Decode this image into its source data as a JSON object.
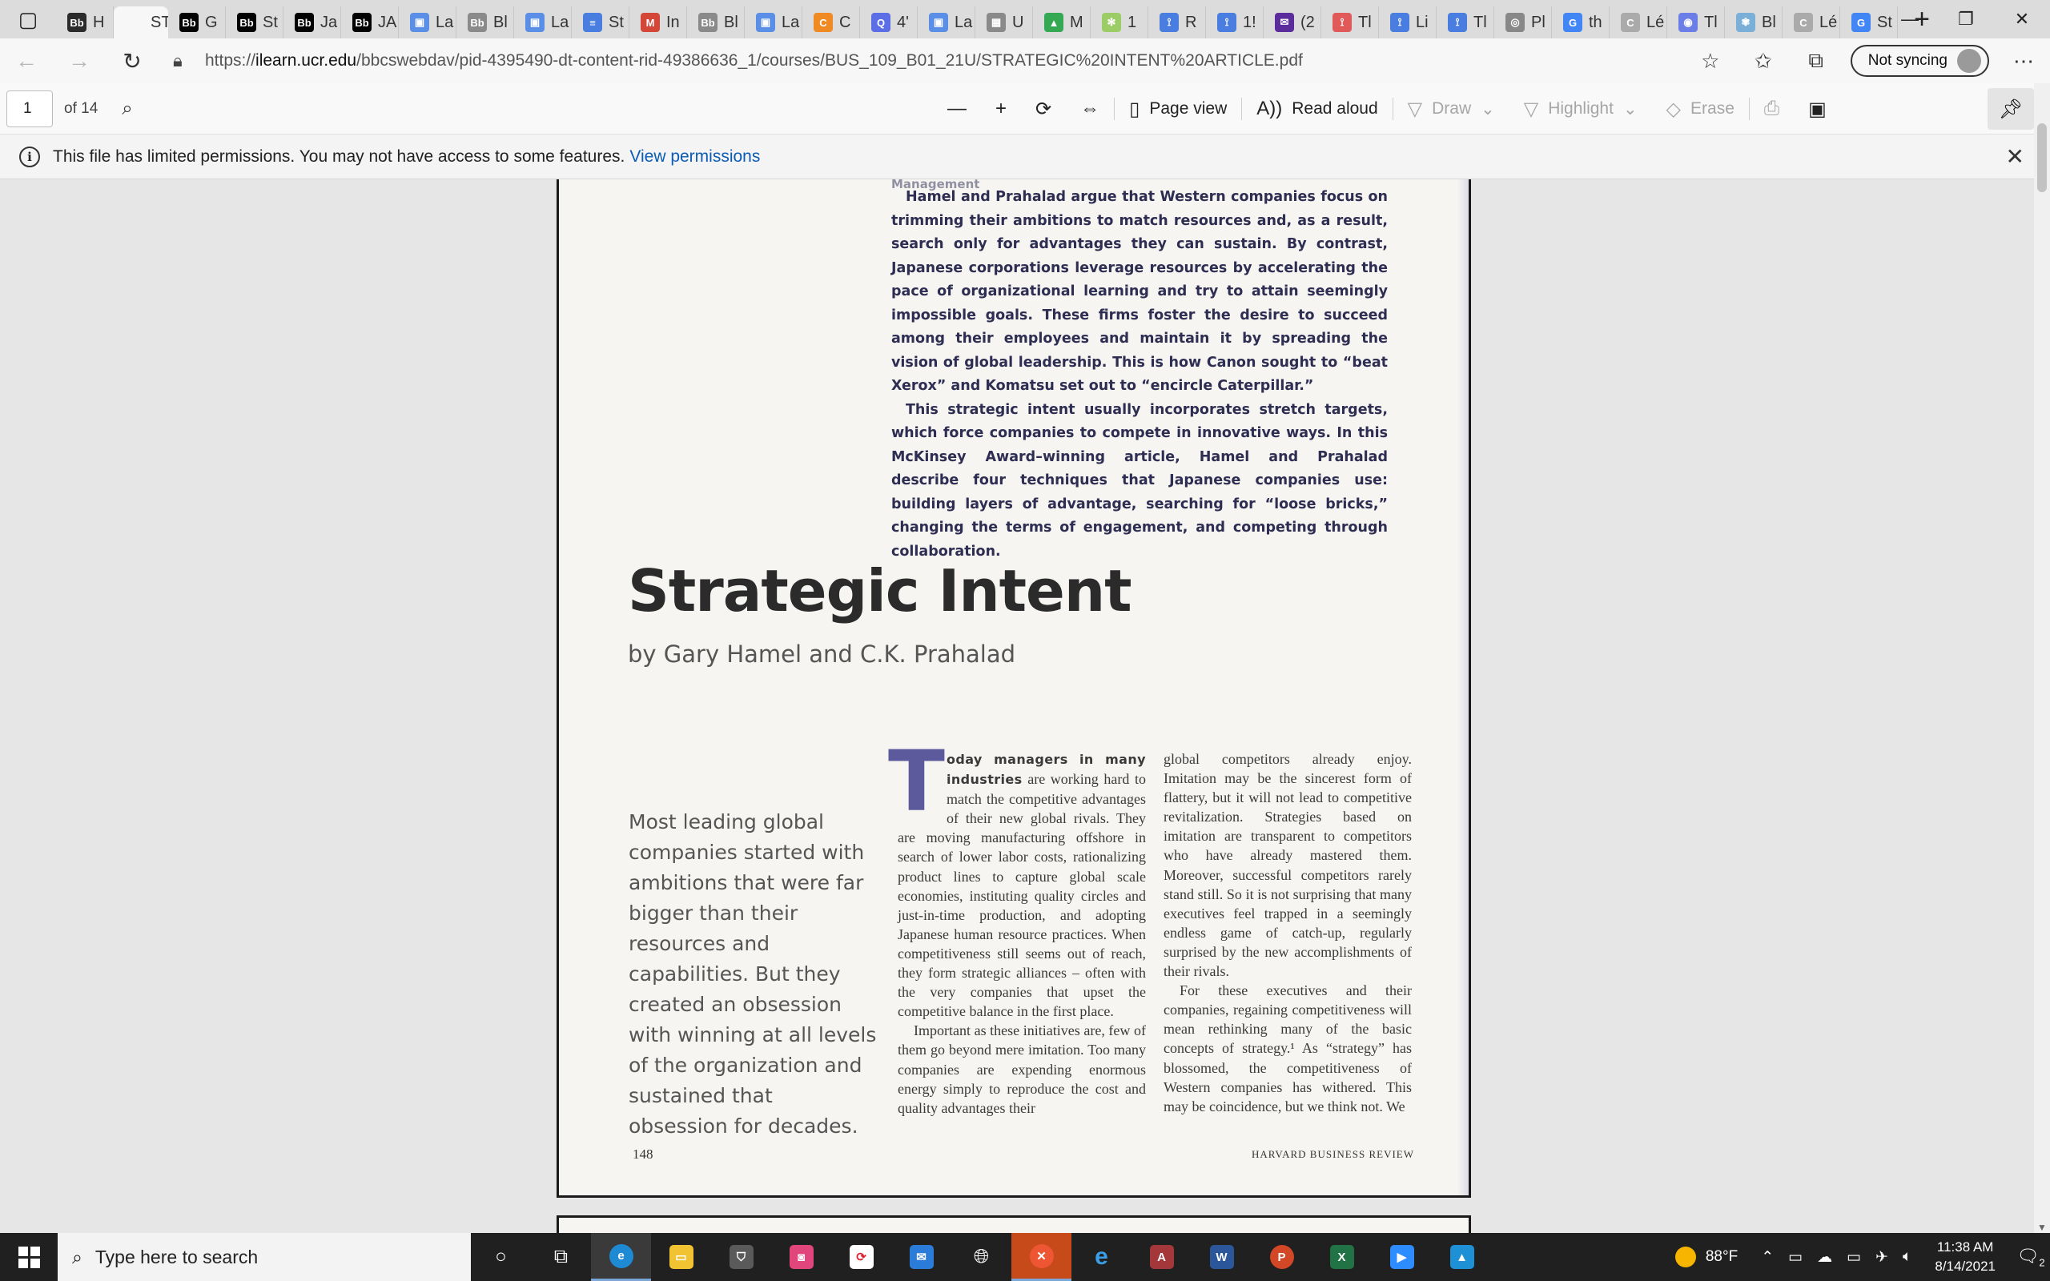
{
  "browser": {
    "tabs": [
      {
        "fav": "Bb",
        "label": "H",
        "color": "#2b2b2b"
      },
      {
        "fav": "",
        "label": "ST",
        "color": "#f7f7f7",
        "active": true
      },
      {
        "fav": "Bb",
        "label": "G",
        "color": "#000"
      },
      {
        "fav": "Bb",
        "label": "St",
        "color": "#000"
      },
      {
        "fav": "Bb",
        "label": "Ja",
        "color": "#000"
      },
      {
        "fav": "Bb",
        "label": "JA",
        "color": "#000"
      },
      {
        "fav": "▣",
        "label": "La",
        "color": "#5b8ee6"
      },
      {
        "fav": "Bb",
        "label": "Bl",
        "color": "#8a8a8a"
      },
      {
        "fav": "▣",
        "label": "La",
        "color": "#5b8ee6"
      },
      {
        "fav": "≡",
        "label": "St",
        "color": "#4a7de0"
      },
      {
        "fav": "M",
        "label": "In",
        "color": "#d44638"
      },
      {
        "fav": "Bb",
        "label": "Bl",
        "color": "#8a8a8a"
      },
      {
        "fav": "▣",
        "label": "La",
        "color": "#5b8ee6"
      },
      {
        "fav": "C",
        "label": "C",
        "color": "#f08a24"
      },
      {
        "fav": "Q",
        "label": "4'",
        "color": "#5b6ee6"
      },
      {
        "fav": "▣",
        "label": "La",
        "color": "#5b8ee6"
      },
      {
        "fav": "▦",
        "label": "U",
        "color": "#8a8a8a"
      },
      {
        "fav": "▲",
        "label": "M",
        "color": "#34a853"
      },
      {
        "fav": "✻",
        "label": "1",
        "color": "#9ccc65"
      },
      {
        "fav": "⟟",
        "label": "R",
        "color": "#4a7de0"
      },
      {
        "fav": "⟟",
        "label": "1!",
        "color": "#4a7de0"
      },
      {
        "fav": "✉",
        "label": "(2",
        "color": "#5b2c9c"
      },
      {
        "fav": "⟟",
        "label": "Tl",
        "color": "#e05a5a"
      },
      {
        "fav": "⟟",
        "label": "Li",
        "color": "#4a7de0"
      },
      {
        "fav": "⟟",
        "label": "Tl",
        "color": "#4a7de0"
      },
      {
        "fav": "◎",
        "label": "Pl",
        "color": "#888"
      },
      {
        "fav": "G",
        "label": "th",
        "color": "#4285f4"
      },
      {
        "fav": "C",
        "label": "Lé",
        "color": "#aaa"
      },
      {
        "fav": "◉",
        "label": "Tl",
        "color": "#6b7de6"
      },
      {
        "fav": "✾",
        "label": "Bl",
        "color": "#7ab0d8"
      },
      {
        "fav": "C",
        "label": "Lé",
        "color": "#aaa"
      },
      {
        "fav": "G",
        "label": "St",
        "color": "#4285f4"
      }
    ],
    "url_prefix": "https://",
    "url_domain": "ilearn.ucr.edu",
    "url_path": "/bbcswebdav/pid-4395490-dt-content-rid-49386636_1/courses/BUS_109_B01_21U/STRATEGIC%20INTENT%20ARTICLE.pdf",
    "sync_label": "Not syncing"
  },
  "pdf": {
    "page_number": "1",
    "page_total": "of 14",
    "tools": {
      "page_view": "Page view",
      "read_aloud": "Read aloud",
      "draw": "Draw",
      "highlight": "Highlight",
      "erase": "Erase"
    },
    "info_message": "This file has limited permissions. You may not have access to some features.",
    "info_link": "View permissions"
  },
  "article": {
    "abstract_cut": "Management",
    "abstract_p1": "Hamel and Prahalad argue that Western companies focus on trimming their ambitions to match resources and, as a result, search only for advantages they can sustain. By contrast, Japanese corporations leverage resources by accelerating the pace of organizational learning and try to attain seemingly impossible goals. These firms foster the desire to succeed among their employees and maintain it by spreading the vision of global leadership. This is how Canon sought to “beat Xerox” and Komatsu set out to “encircle Caterpillar.”",
    "abstract_p2": "This strategic intent usually incorporates stretch targets, which force companies to compete in innovative ways. In this McKinsey Award–winning article, Hamel and Prahalad describe four techniques that Japanese companies use: building layers of advantage, searching for “loose bricks,” changing the terms of engagement, and competing through collaboration.",
    "title": "Strategic Intent",
    "byline": "by Gary Hamel and C.K. Prahalad",
    "pullquote": "Most leading global companies started with ambitions that were far bigger than their resources and capabilities. But they created an obsession with winning at all levels of the organization and sustained that obsession for decades.",
    "dropcap": "T",
    "lead": "oday managers in many industries",
    "col1_p1_rest": " are working hard to match the competitive advantages of their new global rivals. They are moving manufacturing offshore in search of lower labor costs, rationalizing product lines to capture global scale economies, instituting quality circles and just-in-time production, and adopting Japanese human resource practices. When competitiveness still seems out of reach, they form strategic alliances – often with the very companies that upset the competitive balance in the first place.",
    "col1_p2": "Important as these initiatives are, few of them go beyond mere imitation. Too many companies are expending enormous energy simply to reproduce the cost and quality advantages their",
    "col2_p1": "global competitors already enjoy. Imitation may be the sincerest form of flattery, but it will not lead to competitive revitalization. Strategies based on imitation are transparent to competitors who have already mastered them. Moreover, successful competitors rarely stand still. So it is not surprising that many executives feel trapped in a seemingly endless game of catch-up, regularly surprised by the new accomplishments of their rivals.",
    "col2_p2": "For these executives and their companies, regaining competitiveness will mean rethinking many of the basic concepts of strategy.¹ As “strategy” has blossomed, the competitiveness of Western companies has withered. This may be coincidence, but we think not. We",
    "page_number": "148",
    "journal": "HARVARD BUSINESS REVIEW"
  },
  "taskbar": {
    "search_placeholder": "Type here to search",
    "weather": "88°F",
    "time": "11:38 AM",
    "date": "8/14/2021",
    "notifications": "2"
  }
}
